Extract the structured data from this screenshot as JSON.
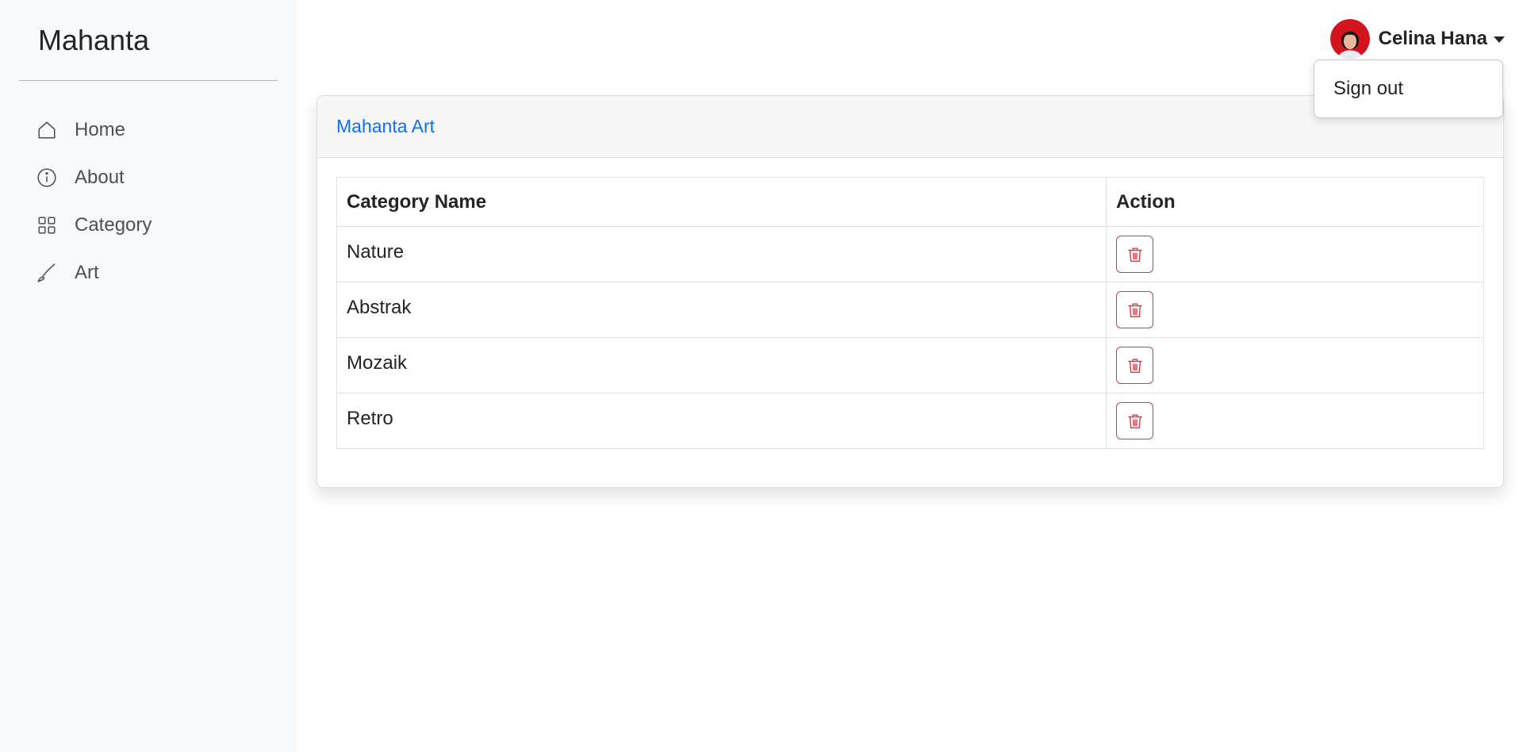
{
  "app": {
    "brand": "Mahanta"
  },
  "sidebar": {
    "items": [
      {
        "label": "Home",
        "icon": "home-icon"
      },
      {
        "label": "About",
        "icon": "info-icon"
      },
      {
        "label": "Category",
        "icon": "grid-icon"
      },
      {
        "label": "Art",
        "icon": "brush-icon"
      }
    ]
  },
  "user": {
    "name": "Celina Hana",
    "avatar_icon": "user-avatar",
    "menu": {
      "sign_out": "Sign out"
    }
  },
  "card": {
    "title": "Mahanta Art",
    "table": {
      "headers": [
        "Category Name",
        "Action"
      ],
      "rows": [
        {
          "name": "Nature"
        },
        {
          "name": "Abstrak"
        },
        {
          "name": "Mozaik"
        },
        {
          "name": "Retro"
        }
      ],
      "row_action_icon": "trash-icon"
    }
  },
  "colors": {
    "accent": "#0d6efd",
    "danger": "#dc3545",
    "sidebar_bg": "#f8f9fa",
    "card_header_bg": "#f7f7f7"
  }
}
